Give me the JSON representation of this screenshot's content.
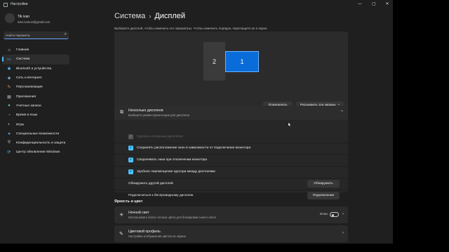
{
  "window": {
    "title": "Настройки",
    "controls": [
      "—",
      "▢",
      "✕"
    ]
  },
  "user": {
    "name": "Tik ivan",
    "email": "ivan.ivanov@gmail.com"
  },
  "search": {
    "placeholder": "Найти параметр"
  },
  "sidebar": {
    "items": [
      {
        "label": "Главная",
        "icon": "home-icon",
        "glyph": "⌂",
        "color": "#e8e8e8"
      },
      {
        "label": "Система",
        "icon": "system-icon",
        "glyph": "▭",
        "color": "#4cc2ff"
      },
      {
        "label": "Bluetooth и устройства",
        "icon": "bluetooth-icon",
        "glyph": "✱",
        "color": "#4cc2ff"
      },
      {
        "label": "Сеть и Интернет",
        "icon": "network-icon",
        "glyph": "◈",
        "color": "#7fd0ff"
      },
      {
        "label": "Персонализация",
        "icon": "personalization-icon",
        "glyph": "✎",
        "color": "#f0a060"
      },
      {
        "label": "Приложения",
        "icon": "apps-icon",
        "glyph": "▦",
        "color": "#a0a8b8"
      },
      {
        "label": "Учетные записи",
        "icon": "accounts-icon",
        "glyph": "●",
        "color": "#5ad08a"
      },
      {
        "label": "Время и язык",
        "icon": "time-language-icon",
        "glyph": "◔",
        "color": "#4cc2ff"
      },
      {
        "label": "Игры",
        "icon": "gaming-icon",
        "glyph": "◐",
        "color": "#a0a8b8"
      },
      {
        "label": "Специальные возможности",
        "icon": "accessibility-icon",
        "glyph": "✦",
        "color": "#4cc2ff"
      },
      {
        "label": "Конфиденциальность и защита",
        "icon": "privacy-shield-icon",
        "glyph": "⛨",
        "color": "#a0a8b8"
      },
      {
        "label": "Центр обновления Windows",
        "icon": "windows-update-icon",
        "glyph": "⟳",
        "color": "#4cc2ff"
      }
    ],
    "active_index": 1
  },
  "content": {
    "breadcrumb_parent": "Система",
    "breadcrumb_separator": "›",
    "breadcrumb_current": "Дисплей",
    "subtitle": "Выберите дисплей, чтобы изменить его параметры. Чтобы изменить порядок, перетащите их в экран."
  },
  "arrangement": {
    "monitor_2": "2",
    "monitor_1": "1",
    "identify_label": "Определить",
    "extend_label": "Расширить эти экраны",
    "extend_chevron": "⌄"
  },
  "multiple_displays": {
    "title": "Несколько дисплеев",
    "subtitle": "Выберите режим презентации для дисплеев",
    "chevron": "⌃",
    "options": [
      {
        "label": "Сделать основным дисплеем",
        "checked": true,
        "disabled": true
      },
      {
        "label": "Сохранять расположение окон в зависимости от подключения монитора",
        "checked": true,
        "disabled": false
      },
      {
        "label": "Сворачивать окна при отключении монитора",
        "checked": true,
        "disabled": false
      },
      {
        "label": "Удобное перемещение курсора между дисплеями",
        "checked": true,
        "disabled": false
      }
    ],
    "check_glyph": "✓",
    "detect_label": "Обнаружить другой дисплей",
    "detect_button": "Обнаружить",
    "connect_label": "Подключиться к беспроводному дисплею",
    "connect_button": "Подключение"
  },
  "brightness": {
    "section_title": "Яркость и цвет",
    "night_light_title": "Ночной свет",
    "night_light_sub": "Использовать более теплые цвета для блокировки синего света",
    "night_light_state": "Откл.",
    "night_light_on": false,
    "color_profile_title": "Цветовой профиль",
    "color_profile_sub": "Настройка отображения цветов на экране",
    "chevron": "›"
  },
  "colors": {
    "accent": "#4cc2ff",
    "selected_monitor": "#0a6cd8",
    "window_bg": "#1f1f1f",
    "card_bg": "#2b2b2b"
  }
}
